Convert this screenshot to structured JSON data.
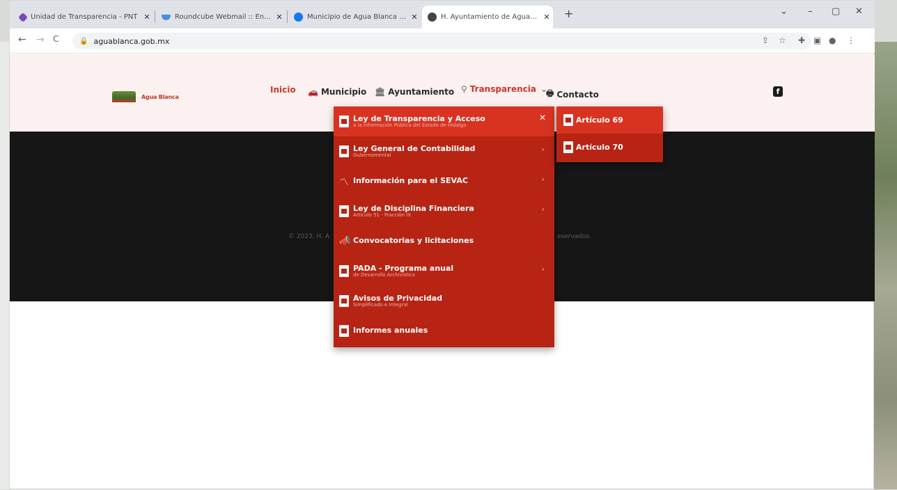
{
  "browser": {
    "tabs": [
      {
        "title": "Unidad de Transparencia - PNT",
        "favicon_color": "#7b4bb5",
        "active": false
      },
      {
        "title": "Roundcube Webmail :: Entrada",
        "favicon_color": "#4a90d9",
        "active": false
      },
      {
        "title": "Municipio de Agua Blanca de It",
        "favicon_color": "#1877f2",
        "active": false
      },
      {
        "title": "H. Ayuntamiento de Aguablanca",
        "favicon_color": "#444444",
        "active": true
      }
    ],
    "tab_close": "✕",
    "new_tab": "+",
    "window_controls": {
      "expand": "⌄",
      "minimize": "–",
      "restore": "▢",
      "close": "✕"
    },
    "nav": {
      "back": "←",
      "forward": "→",
      "reload": "C"
    },
    "url": "aguablanca.gob.mx",
    "toolbar_icons": [
      "share-icon",
      "star-icon",
      "extensions-icon",
      "sidepanel-icon",
      "profile-icon",
      "menu-icon"
    ]
  },
  "site": {
    "logo_text": "Agua Blanca",
    "nav": [
      {
        "label": "Inicio",
        "icon": "",
        "highlight": true
      },
      {
        "label": "Municipio",
        "icon": "car-icon",
        "highlight": false
      },
      {
        "label": "Ayuntamiento",
        "icon": "building-icon",
        "highlight": false
      },
      {
        "label": "Transparencia",
        "icon": "search-icon",
        "highlight": true,
        "caret": "⌄"
      },
      {
        "label": "Contacto",
        "icon": "printer-icon",
        "highlight": false
      }
    ],
    "social": "f",
    "footer_left": "© 2023. H. A",
    "footer_right": "eservados."
  },
  "dropdown": {
    "items": [
      {
        "title": "Ley de Transparencia y Acceso",
        "sub": "a la Información Pública del Estado de Hidalgo",
        "icon": "document-icon",
        "action": "✕",
        "active": true
      },
      {
        "title": "Ley General de Contabilidad",
        "sub": "Gubernamental",
        "icon": "document-icon",
        "action": "›",
        "active": false
      },
      {
        "title": "Información para el SEVAC",
        "sub": "",
        "icon": "signal-icon",
        "action": "›",
        "active": false
      },
      {
        "title": "Ley de Disciplina Financiera",
        "sub": "Artículo 51 - Fracción IX",
        "icon": "document-icon",
        "action": "›",
        "active": false
      },
      {
        "title": "Convocatorias y licitaciones",
        "sub": "",
        "icon": "megaphone-icon",
        "action": "",
        "active": false
      },
      {
        "title": "PADA - Programa anual",
        "sub": "de Desarrollo Archivístico",
        "icon": "document-icon",
        "action": "›",
        "active": false
      },
      {
        "title": "Avisos de Privacidad",
        "sub": "Simplificado e Integral",
        "icon": "document-icon",
        "action": "",
        "active": false
      },
      {
        "title": "Informes anuales",
        "sub": "",
        "icon": "document-icon",
        "action": "",
        "active": false
      }
    ],
    "submenu": [
      {
        "label": "Artículo 69",
        "icon": "document-icon",
        "active": true
      },
      {
        "label": "Artículo 70",
        "icon": "document-icon",
        "active": false
      }
    ]
  }
}
